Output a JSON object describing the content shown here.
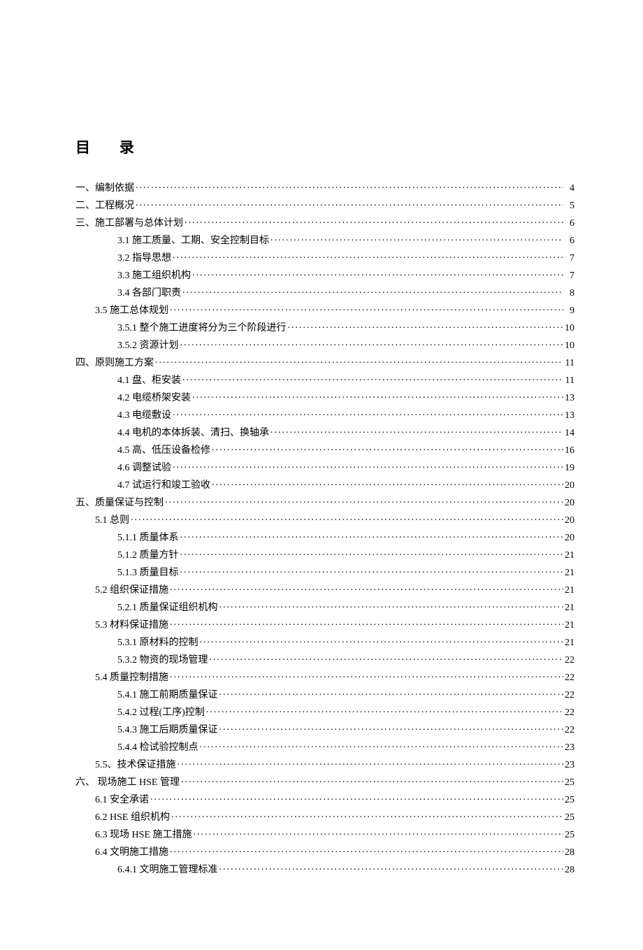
{
  "title": "目 录",
  "toc": [
    {
      "label": "一、编制依据",
      "page": "4",
      "indent": 0
    },
    {
      "label": "二、工程概况",
      "page": "5",
      "indent": 0
    },
    {
      "label": "三、施工部署与总体计划",
      "page": "6",
      "indent": 0
    },
    {
      "label": "3.1 施工质量、工期、安全控制目标",
      "page": "6",
      "indent": 2
    },
    {
      "label": "3.2 指导思想",
      "page": "7",
      "indent": 2
    },
    {
      "label": "3.3 施工组织机构",
      "page": "7",
      "indent": 2
    },
    {
      "label": "3.4 各部门职责",
      "page": "8",
      "indent": 2
    },
    {
      "label": "3.5 施工总体规划",
      "page": "9",
      "indent": 1
    },
    {
      "label": "3.5.1 整个施工进度将分为三个阶段进行",
      "page": "10",
      "indent": 2
    },
    {
      "label": "3.5.2 资源计划",
      "page": "10",
      "indent": 2
    },
    {
      "label": "四、原则施工方案",
      "page": "11",
      "indent": 0
    },
    {
      "label": "4.1 盘、柜安装",
      "page": "11",
      "indent": 2
    },
    {
      "label": "4.2 电缆桥架安装",
      "page": "13",
      "indent": 2
    },
    {
      "label": "4.3 电缆敷设",
      "page": "13",
      "indent": 2
    },
    {
      "label": "4.4 电机的本体拆装、清扫、换轴承",
      "page": "14",
      "indent": 2
    },
    {
      "label": "4.5 高、低压设备检修",
      "page": "16",
      "indent": 2
    },
    {
      "label": "4.6 调整试验",
      "page": "19",
      "indent": 2
    },
    {
      "label": "4.7 试运行和竣工验收",
      "page": "20",
      "indent": 2
    },
    {
      "label": "五、质量保证与控制",
      "page": "20",
      "indent": 0
    },
    {
      "label": "5.1 总则",
      "page": "20",
      "indent": 1
    },
    {
      "label": "5.1.1 质量体系",
      "page": "20",
      "indent": 2
    },
    {
      "label": "5.1.2 质量方针",
      "page": "21",
      "indent": 2
    },
    {
      "label": "5.1.3 质量目标",
      "page": "21",
      "indent": 2
    },
    {
      "label": "5.2 组织保证措施",
      "page": "21",
      "indent": 1
    },
    {
      "label": "5.2.1 质量保证组织机构",
      "page": "21",
      "indent": 2
    },
    {
      "label": "5.3 材料保证措施",
      "page": "21",
      "indent": 1
    },
    {
      "label": "5.3.1 原材料的控制",
      "page": "21",
      "indent": 2
    },
    {
      "label": "5.3.2 物资的现场管理",
      "page": "22",
      "indent": 2
    },
    {
      "label": "5.4 质量控制措施",
      "page": "22",
      "indent": 1
    },
    {
      "label": "5.4.1 施工前期质量保证",
      "page": "22",
      "indent": 2
    },
    {
      "label": "5.4.2 过程(工序)控制",
      "page": "22",
      "indent": 2
    },
    {
      "label": "5.4.3 施工后期质量保证",
      "page": "22",
      "indent": 2
    },
    {
      "label": "5.4.4 检试验控制点",
      "page": "23",
      "indent": 2
    },
    {
      "label": "5.5、技术保证措施",
      "page": "23",
      "indent": 1
    },
    {
      "label": "六、 现场施工 HSE 管理  ",
      "page": "25",
      "indent": 0
    },
    {
      "label": "6.1 安全承诺",
      "page": "25",
      "indent": 1
    },
    {
      "label": "6.2 HSE 组织机构",
      "page": "25",
      "indent": 1
    },
    {
      "label": "6.3 现场 HSE 施工措施",
      "page": "25",
      "indent": 1
    },
    {
      "label": "6.4 文明施工措施",
      "page": "28",
      "indent": 1
    },
    {
      "label": "6.4.1 文明施工管理标准",
      "page": "28",
      "indent": 2
    }
  ]
}
